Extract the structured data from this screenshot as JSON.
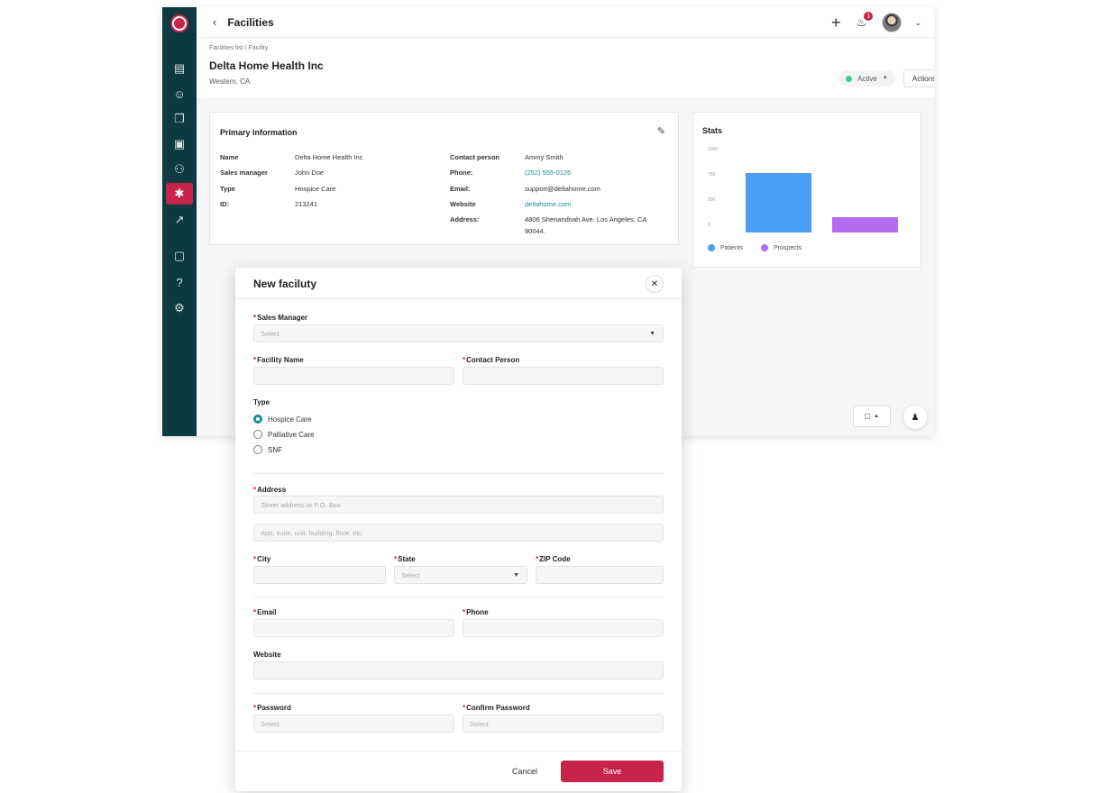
{
  "topbar": {
    "back_icon": "chevron-left-icon",
    "title": "Facilities",
    "notification_count": "1"
  },
  "sidebar": {
    "items": [
      {
        "name": "map-icon",
        "glyph": "▤"
      },
      {
        "name": "user-add-icon",
        "glyph": "☺"
      },
      {
        "name": "documents-icon",
        "glyph": "❐"
      },
      {
        "name": "dashboard-icon",
        "glyph": "▣"
      },
      {
        "name": "users-icon",
        "glyph": "⚇"
      },
      {
        "name": "facility-icon",
        "glyph": "✱",
        "active": true
      },
      {
        "name": "analytics-icon",
        "glyph": "↗"
      },
      {
        "name": "chat-icon",
        "glyph": "▢"
      },
      {
        "name": "help-icon",
        "glyph": "?"
      },
      {
        "name": "settings-icon",
        "glyph": "⚙"
      }
    ]
  },
  "header": {
    "breadcrumb": "Facilities list / Facility",
    "title": "Delta Home Health Inc",
    "subtitle": "Western, CA",
    "status": "Active",
    "actions_label": "Actions"
  },
  "primary": {
    "title": "Primary Information",
    "left": [
      {
        "k": "Name",
        "v": "Delta Home Health Inc"
      },
      {
        "k": "Sales manager",
        "v": "John Doe"
      },
      {
        "k": "Type",
        "v": "Hospice Care"
      },
      {
        "k": "ID:",
        "v": "213241"
      }
    ],
    "right": [
      {
        "k": "Contact person",
        "v": "Ammy Smith"
      },
      {
        "k": "Phone:",
        "v": "(252) 555-0126"
      },
      {
        "k": "Email:",
        "v": "support@deltahome.com"
      },
      {
        "k": "Website",
        "v": "deltahome.com"
      },
      {
        "k": "Address:",
        "v": "4806 Shenandoah Ave, Los Angeles, CA",
        "v2": "90044."
      }
    ]
  },
  "stats": {
    "title": "Stats",
    "colors": {
      "patients": "#4a9ff5",
      "prospects": "#b36cf0"
    }
  },
  "chart_data": {
    "type": "bar",
    "categories": [
      "Patients",
      "Prospects"
    ],
    "values": [
      720,
      190
    ],
    "ylim": [
      0,
      1000
    ],
    "yticks": [
      "1000",
      "750",
      "500",
      "0"
    ],
    "legend": [
      "Patients",
      "Prospects"
    ]
  },
  "modal": {
    "title": "New faciluty",
    "sales_manager": {
      "label": "Sales Manager",
      "placeholder": "Select"
    },
    "facility_name": {
      "label": "Facility Name"
    },
    "contact_person": {
      "label": "Contact Person"
    },
    "type": {
      "label": "Type",
      "options": [
        "Hospice Care",
        "Palliative Care",
        "SNF"
      ],
      "selected": "Hospice Care"
    },
    "address": {
      "label": "Address",
      "line1_placeholder": "Street address or P.O. Box",
      "line2_placeholder": "App, suite, unit, building, floor, etc."
    },
    "city": {
      "label": "City"
    },
    "state": {
      "label": "State",
      "placeholder": "Select"
    },
    "zip": {
      "label": "ZIP Code"
    },
    "email": {
      "label": "Email"
    },
    "phone": {
      "label": "Phone"
    },
    "website": {
      "label": "Website"
    },
    "password": {
      "label": "Password",
      "placeholder": "Select"
    },
    "confirm_password": {
      "label": "Confirm Password",
      "placeholder": "Select"
    },
    "cancel_label": "Cancel",
    "save_label": "Save"
  }
}
